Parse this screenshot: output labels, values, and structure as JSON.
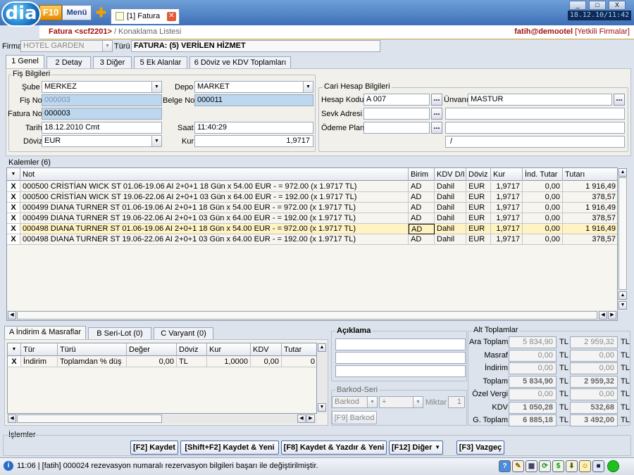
{
  "titlebar": {
    "logo": "dia",
    "f10": "F10",
    "menu": "Menü",
    "tab_label": "[1] Fatura",
    "clock": "18.12.10/11:42",
    "min": "_",
    "restore": "□",
    "close": "X"
  },
  "breadcrumb": {
    "title": "Fatura <scf2201>",
    "sep": " / Konaklama Listesi",
    "user": "fatih@demootel",
    "firms": "[Yetkili Firmalar]"
  },
  "header": {
    "firma_label": "Firma",
    "firma_value": "HOTEL GARDEN",
    "turu_label": "Türü",
    "turu_value": "FATURA: (5) VERİLEN HİZMET"
  },
  "tabs": [
    "1 Genel",
    "2 Detay",
    "3 Diğer",
    "5 Ek Alanlar",
    "6 Döviz ve KDV Toplamları"
  ],
  "fis": {
    "group_title": "Fiş Bilgileri",
    "sube_label": "Şube",
    "sube": "MERKEZ",
    "depo_label": "Depo",
    "depo": "MARKET",
    "fisno_label": "Fiş No",
    "fisno": "000003",
    "belgeno_label": "Belge No",
    "belgeno": "000011",
    "faturano_label": "Fatura No",
    "faturano": "000003",
    "tarih_label": "Tarih",
    "tarih": "18.12.2010 Cmt",
    "saat_label": "Saat",
    "saat": "11:40:29",
    "doviz_label": "Döviz",
    "doviz": "EUR",
    "kur_label": "Kur",
    "kur": "1,9717"
  },
  "cari": {
    "group_title": "Cari Hesap Bilgileri",
    "hesap_label": "Hesap Kodu",
    "hesap": "A 007",
    "unvan_label": "Ünvanı",
    "unvan": "MASTUR",
    "sevk_label": "Sevk Adresi",
    "odeme_label": "Ödeme Planı",
    "slash": "/"
  },
  "kalemler": {
    "title": "Kalemler (6)",
    "columns": [
      "Not",
      "Birim",
      "KDV D/I",
      "Döviz",
      "Kur",
      "İnd. Tutar",
      "Tutarı"
    ],
    "rows": [
      [
        "000500  CRİSTİAN WICK ST              01.06-19.06 AI 2+0+1 18 Gün x  54.00 EUR -  =  972.00 (x 1.9717 TL)",
        "AD",
        "Dahil",
        "EUR",
        "1,9717",
        "0,00",
        "1 916,49"
      ],
      [
        "000500  CRİSTİAN WICK ST              19.06-22.06 AI 2+0+1 03 Gün x  64.00 EUR -  =  192.00 (x 1.9717 TL)",
        "AD",
        "Dahil",
        "EUR",
        "1,9717",
        "0,00",
        "378,57"
      ],
      [
        "000499  DIANA TURNER    ST              01.06-19.06 AI 2+0+1 18 Gün x  54.00 EUR -  =  972.00 (x 1.9717 TL)",
        "AD",
        "Dahil",
        "EUR",
        "1,9717",
        "0,00",
        "1 916,49"
      ],
      [
        "000499  DIANA TURNER    ST              19.06-22.06 AI 2+0+1 03 Gün x  64.00 EUR -  =  192.00 (x 1.9717 TL)",
        "AD",
        "Dahil",
        "EUR",
        "1,9717",
        "0,00",
        "378,57"
      ],
      [
        "000498  DIANA TURNER    ST              01.06-19.06 AI 2+0+1 18 Gün x  54.00 EUR -  =  972.00 (x 1.9717 TL)",
        "AD",
        "Dahil",
        "EUR",
        "1,9717",
        "0,00",
        "1 916,49"
      ],
      [
        "000498  DIANA TURNER    ST              19.06-22.06 AI 2+0+1 03 Gün x  64.00 EUR -  =  192.00 (x 1.9717 TL)",
        "AD",
        "Dahil",
        "EUR",
        "1,9717",
        "0,00",
        "378,57"
      ]
    ],
    "selected_row": 4,
    "row_marker": "X"
  },
  "bottom_tabs": [
    "A İndirim & Masraflar",
    "B Seri-Lot (0)",
    "C Varyant (0)"
  ],
  "indirim": {
    "columns": [
      "Tür",
      "Türü",
      "Değer",
      "Döviz",
      "Kur",
      "KDV",
      "Tutar"
    ],
    "rows": [
      [
        "İndirim",
        "Toplamdan % düş",
        "0,00",
        "TL",
        "1,0000",
        "0,00",
        "0"
      ]
    ]
  },
  "aciklama": {
    "title": "Açıklama"
  },
  "barkod": {
    "title": "Barkod-Seri",
    "type": "Barkod",
    "op": "+",
    "miktar_label": "Miktar",
    "miktar": "1",
    "button": "[F9] Barkod"
  },
  "alt": {
    "title": "Alt Toplamlar",
    "rows": [
      {
        "label": "Ara Toplam",
        "v1": "5 834,90",
        "c1": "TL",
        "v2": "2 959,32",
        "c2": "TL",
        "bold": false
      },
      {
        "label": "Masraf",
        "v1": "0,00",
        "c1": "TL",
        "v2": "0,00",
        "c2": "TL",
        "bold": false
      },
      {
        "label": "İndirim",
        "v1": "0,00",
        "c1": "TL",
        "v2": "0,00",
        "c2": "TL",
        "bold": false
      },
      {
        "label": "Toplam",
        "v1": "5 834,90",
        "c1": "TL",
        "v2": "2 959,32",
        "c2": "TL",
        "bold": true
      },
      {
        "label": "Özel Vergi",
        "v1": "0,00",
        "c1": "TL",
        "v2": "0,00",
        "c2": "TL",
        "bold": false
      },
      {
        "label": "KDV",
        "v1": "1 050,28",
        "c1": "TL",
        "v2": "532,68",
        "c2": "TL",
        "bold": true
      },
      {
        "label": "G. Toplam",
        "v1": "6 885,18",
        "c1": "TL",
        "v2": "3 492,00",
        "c2": "TL",
        "bold": true
      }
    ]
  },
  "islemler": {
    "title": "İşlemler",
    "kaydet": "[F2] Kaydet",
    "kaydet_yeni": "[Shift+F2] Kaydet & Yeni",
    "kaydet_yazdir": "[F8] Kaydet & Yazdır & Yeni",
    "diger": "[F12] Diğer",
    "vazgec": "[F3] Vazgeç"
  },
  "status": {
    "text": "11:06 | [fatih] 000024 rezevasyon numaralı rezervasyon bilgileri başarı ile değiştirilmiştir."
  },
  "colors": {
    "accent": "#3e6fb8",
    "selected_row": "#fff3c4",
    "brand_red": "#a01010"
  }
}
